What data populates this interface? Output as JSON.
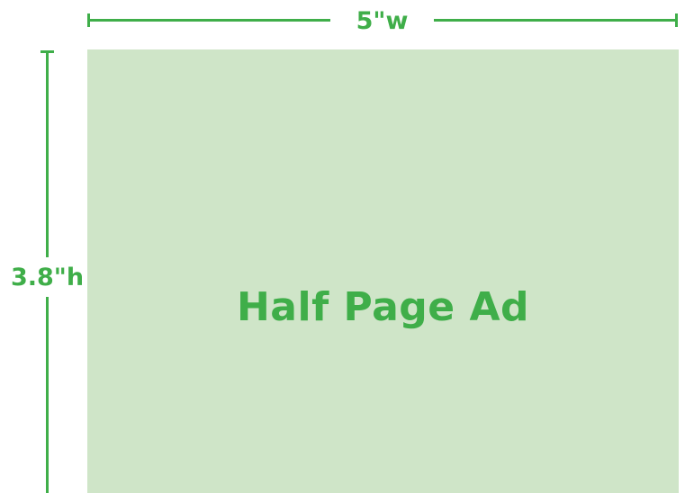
{
  "dimensions": {
    "width_label": "5\"w",
    "height_label": "3.8\"h"
  },
  "ad": {
    "title": "Half Page Ad"
  },
  "colors": {
    "accent": "#3fae49",
    "ad_fill": "#cfe5c8",
    "background": "#ffffff"
  }
}
